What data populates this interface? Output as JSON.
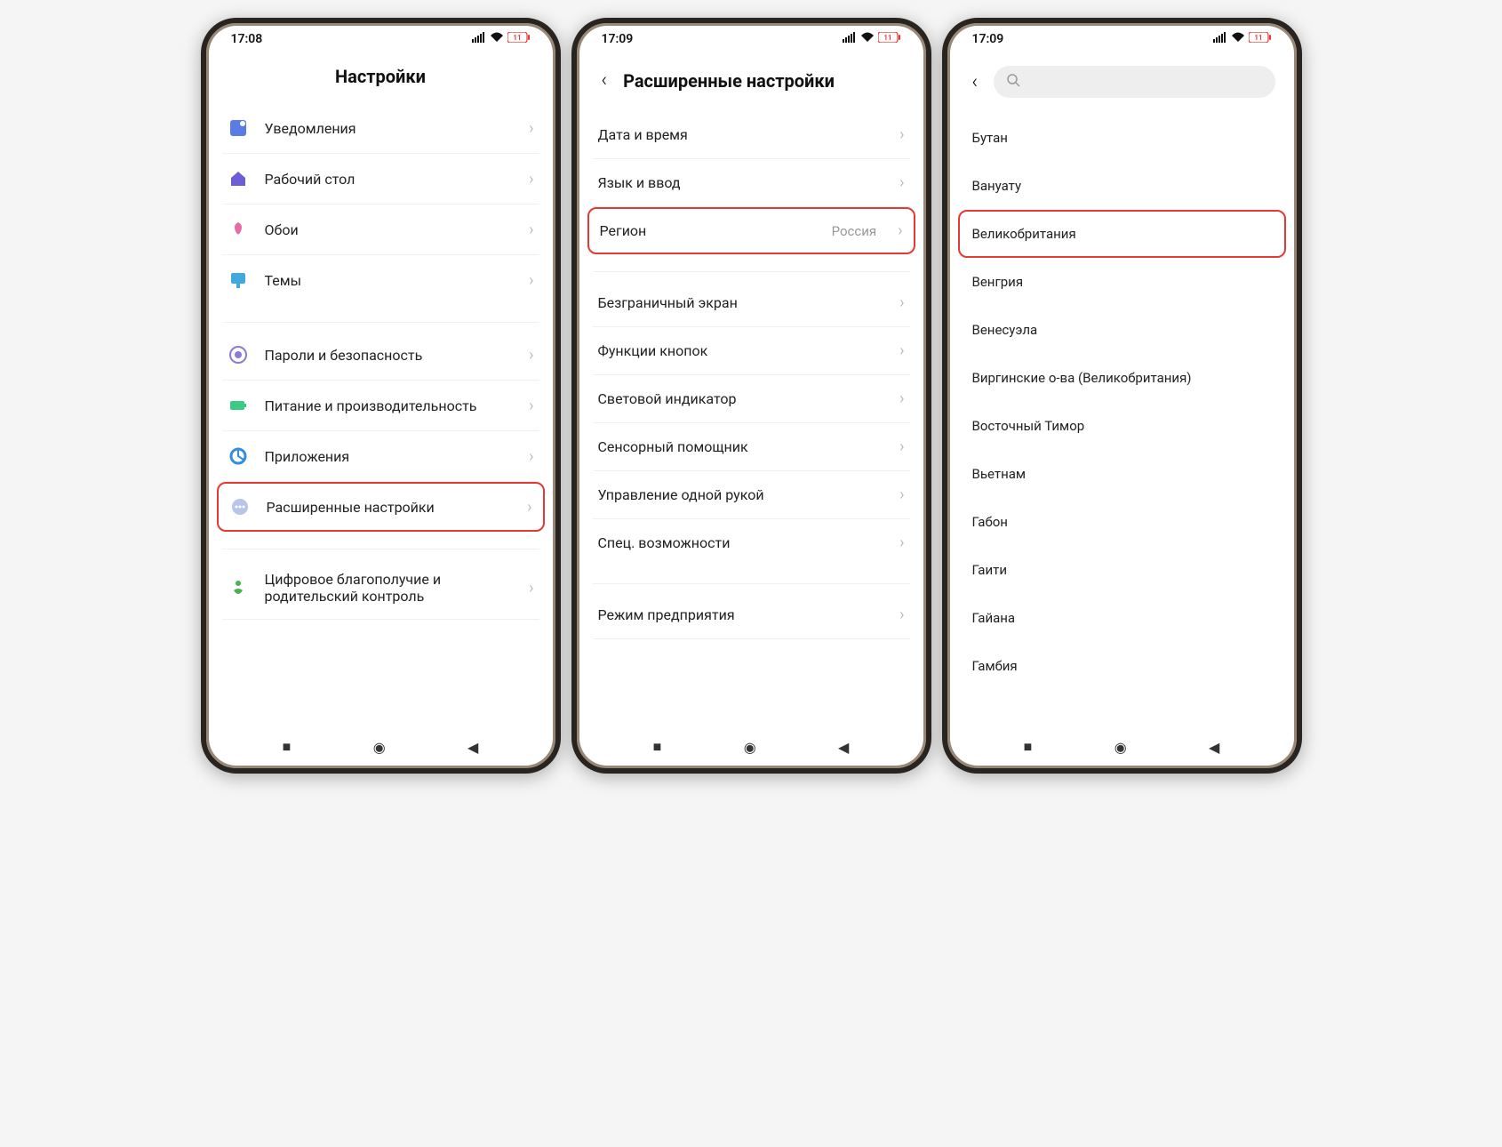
{
  "phone1": {
    "time": "17:08",
    "battery": "11",
    "title": "Настройки",
    "items": [
      {
        "label": "Уведомления",
        "icon": "notification"
      },
      {
        "label": "Рабочий стол",
        "icon": "home"
      },
      {
        "label": "Обои",
        "icon": "wallpaper"
      },
      {
        "label": "Темы",
        "icon": "themes"
      },
      {
        "label": "Пароли и безопасность",
        "icon": "security"
      },
      {
        "label": "Питание и производительность",
        "icon": "battery"
      },
      {
        "label": "Приложения",
        "icon": "apps"
      },
      {
        "label": "Расширенные настройки",
        "icon": "advanced",
        "highlighted": true
      },
      {
        "label": "Цифровое благополучие и родительский контроль",
        "icon": "wellbeing"
      }
    ]
  },
  "phone2": {
    "time": "17:09",
    "battery": "11",
    "title": "Расширенные настройки",
    "items": [
      {
        "label": "Дата и время"
      },
      {
        "label": "Язык и ввод"
      },
      {
        "label": "Регион",
        "value": "Россия",
        "highlighted": true
      },
      {
        "label": "Безграничный экран"
      },
      {
        "label": "Функции кнопок"
      },
      {
        "label": "Световой индикатор"
      },
      {
        "label": "Сенсорный помощник"
      },
      {
        "label": "Управление одной рукой"
      },
      {
        "label": "Спец. возможности"
      },
      {
        "label": "Режим предприятия"
      }
    ]
  },
  "phone3": {
    "time": "17:09",
    "battery": "11",
    "regions": [
      "Бутан",
      "Вануату",
      "Великобритания",
      "Венгрия",
      "Венесуэла",
      "Виргинские о-ва (Великобритания)",
      "Восточный Тимор",
      "Вьетнам",
      "Габон",
      "Гаити",
      "Гайана",
      "Гамбия"
    ],
    "highlighted_index": 2
  }
}
